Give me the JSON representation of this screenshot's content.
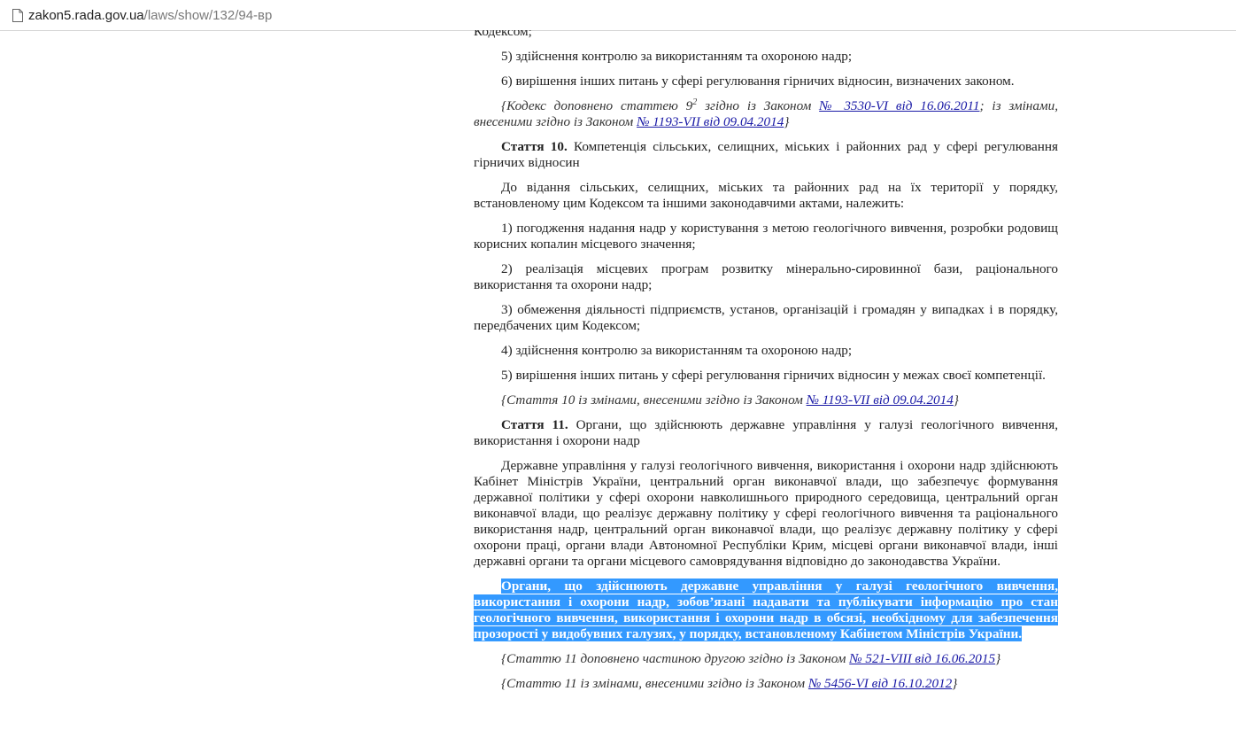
{
  "browser": {
    "url_host": "zakon5.rada.gov.ua",
    "url_path": "/laws/show/132/94-вр"
  },
  "doc": {
    "p0": "Кодексом;",
    "p1": "5) здійснення контролю за використанням та охороною надр;",
    "p2": "6) вирішення інших питань у сфері регулювання гірничих відносин, визначених законом.",
    "n1": {
      "t1": "{Кодекс доповнено статтею 9",
      "sup": "2",
      "t2": " згідно із Законом ",
      "link1": "№ 3530-VI від 16.06.2011",
      "t3": "; із змінами, внесеними згідно із Законом ",
      "link2": "№ 1193-VII від 09.04.2014",
      "t4": "}"
    },
    "a10_label": "Стаття 10.",
    "a10_title": " Компетенція сільських, селищних, міських і районних рад у сфері регулювання гірничих відносин",
    "a10_p1": "До відання сільських, селищних, міських та районних рад на їх території у порядку, встановленому цим Кодексом та іншими законодавчими актами, належить:",
    "a10_p2": "1) погодження надання надр у користування з метою геологічного вивчення, розробки родовищ корисних копалин місцевого значення;",
    "a10_p3": "2) реалізація місцевих програм розвитку мінерально-сировинної бази, раціонального використання та охорони надр;",
    "a10_p4": "3) обмеження діяльності підприємств, установ, організацій і громадян у випадках і в порядку, передбачених цим Кодексом;",
    "a10_p5": "4) здійснення контролю за використанням та охороною надр;",
    "a10_p6": "5) вирішення інших питань у сфері регулювання гірничих відносин у межах своєї компетенції.",
    "n2": {
      "t1": "{Стаття 10 із змінами, внесеними згідно із Законом ",
      "link": "№ 1193-VII від 09.04.2014",
      "t2": "}"
    },
    "a11_label": "Стаття 11.",
    "a11_title": " Органи, що здійснюють державне управління у галузі геологічного вивчення, використання і охорони надр",
    "a11_p1": "Державне управління у галузі геологічного вивчення, використання і охорони надр здійснюють Кабінет Міністрів України, центральний орган виконавчої влади, що забезпечує формування державної політики у сфері охорони навколишнього природного середовища, центральний орган виконавчої влади, що реалізує державну політику у сфері геологічного вивчення та раціонального використання надр, центральний орган виконавчої влади, що реалізує державну політику у сфері охорони праці, органи влади Автономної Республіки Крим, місцеві органи виконавчої влади, інші державні органи та органи місцевого самоврядування відповідно до законодавства України.",
    "a11_p2": "Органи, що здійснюють державне управління у галузі геологічного вивчення, використання і охорони надр, зобов’язані надавати та публікувати інформацію про стан геологічного вивчення, використання і охорони надр в обсязі, необхідному для забезпечення прозорості у видобувних галузях, у порядку, встановленому Кабінетом Міністрів України.",
    "n3": {
      "t1": "{Статтю 11 доповнено частиною другою згідно із Законом ",
      "link": "№ 521-VIII від 16.06.2015",
      "t2": "}"
    },
    "n4": {
      "t1": "{Статтю 11 із змінами, внесеними згідно із Законом ",
      "link": "№ 5456-VI від 16.10.2012",
      "t2": "}"
    }
  }
}
